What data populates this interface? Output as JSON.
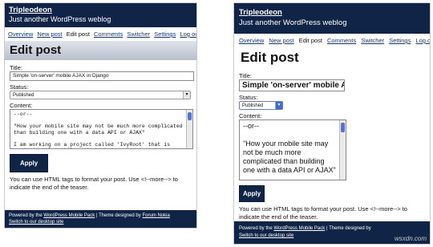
{
  "header": {
    "site_title": "Tripleodeon",
    "tagline": "Just another WordPress weblog"
  },
  "nav": [
    "Overview",
    "New post",
    "Edit post",
    "Comments",
    "Switcher",
    "Settings",
    "Log out"
  ],
  "nav_current": "Edit post",
  "page_title": "Edit post",
  "form": {
    "title_label": "Title:",
    "title_value": "Simple 'on-server' mobile AJAX in Django",
    "title_value_right": "Simple 'on-server' mobile AJAX",
    "status_label": "Status:",
    "status_value": "Published",
    "content_label": "Content:",
    "content_left": "--or--\n\n\"How your mobile site may not be much more complicated than building one with a data API or AJAX\"\n\nI am working on a project called 'IvyRoot' that is predominantly mobile and which is going to make me",
    "content_right": "--or--\n\n\"How your mobile site may not be much more complicated than building one with a data API or AJAX\"",
    "apply_label": "Apply",
    "help_text": "You can use HTML tags to format your post. Use <!--more--> to indicate the end of the teaser."
  },
  "footer": {
    "powered_prefix": "Powered by the ",
    "pack_link": "WordPress Mobile Pack",
    "theme_prefix": " | Theme designed by ",
    "theme_link": "Forum Nokia",
    "switch_link": "Switch to our desktop site"
  },
  "watermark": "wsxdn.com",
  "colors": {
    "header_bg": "#0f2446",
    "link": "#14366e",
    "scroll_thumb": "#4f76d6"
  }
}
